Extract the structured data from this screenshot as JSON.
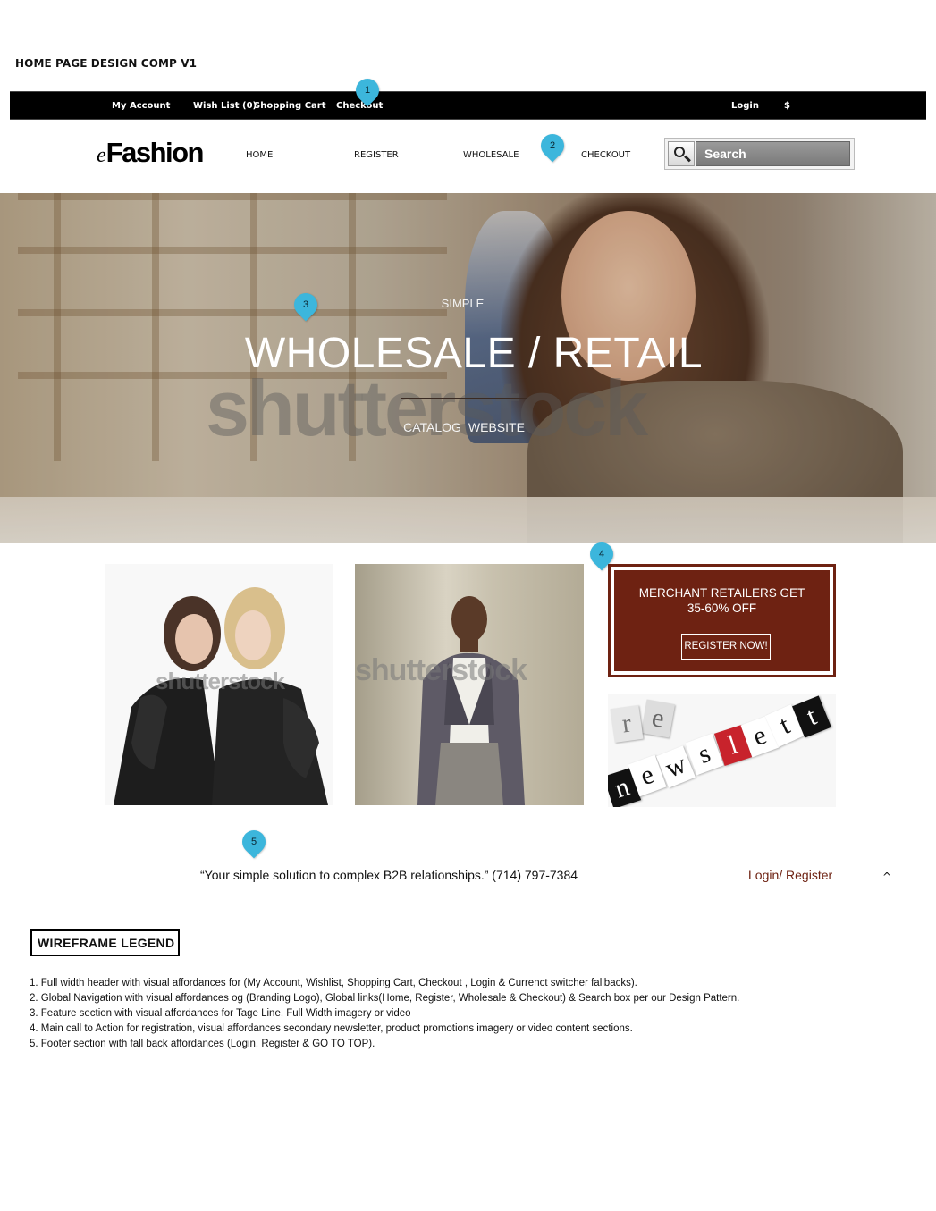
{
  "comp_title": "HOME PAGE DESIGN COMP V1",
  "topbar": {
    "my_account": "My Account",
    "wish_list": "Wish List (0)",
    "shopping_cart": "Shopping Cart",
    "checkout": "Checkout",
    "login": "Login",
    "currency": "$"
  },
  "callouts": [
    "1",
    "2",
    "3",
    "4",
    "5"
  ],
  "brand": {
    "logo_prefix": "e",
    "logo_main": "Fashion"
  },
  "nav": {
    "items": [
      {
        "label": "HOME"
      },
      {
        "label": "REGISTER"
      },
      {
        "label": "WHOLESALE"
      },
      {
        "label": "CHECKOUT"
      }
    ]
  },
  "search": {
    "placeholder": "Search",
    "icon": "magnifier-icon"
  },
  "hero": {
    "kicker": "SIMPLE",
    "title": "WHOLESALE / RETAIL",
    "sub_left": "CATALOG",
    "sub_right": "WEBSITE",
    "watermark": "shutterstock"
  },
  "tiles": {
    "tile_a_watermark": "shutterstock",
    "tile_b_watermark": "shutterstock"
  },
  "promo": {
    "text": "MERCHANT RETAILERS GET 35-60% OFF",
    "button": "REGISTER NOW!"
  },
  "newsletter": {
    "letters": [
      "n",
      "e",
      "w",
      "s",
      "l",
      "e",
      "t",
      "t",
      "e",
      "r"
    ]
  },
  "footer": {
    "quote": "“Your simple solution to complex B2B relationships.”  (714) 797-7384",
    "login_register": "Login/ Register",
    "go_top": "^"
  },
  "legend": {
    "title": "WIREFRAME LEGEND",
    "items": [
      "1. Full width header with visual affordances for (My Account, Wishlist, Shopping Cart, Checkout , Login & Currenct switcher fallbacks).",
      "2. Global Navigation with visual affordances og (Branding Logo), Global links(Home, Register, Wholesale & Checkout) & Search box per our Design Pattern.",
      "3. Feature section with visual affordances  for Tage Line, Full Width imagery or video",
      "4. Main call to Action for registration, visual affordances secondary newsletter, product promotions imagery or video content sections.",
      "5. Footer section with fall back affordances (Login, Register & GO TO TOP)."
    ]
  },
  "colors": {
    "topbar_bg": "#000000",
    "callout_pin": "#3cb6dc",
    "promo_brown": "#6e2212",
    "footer_link": "#6e2212"
  }
}
